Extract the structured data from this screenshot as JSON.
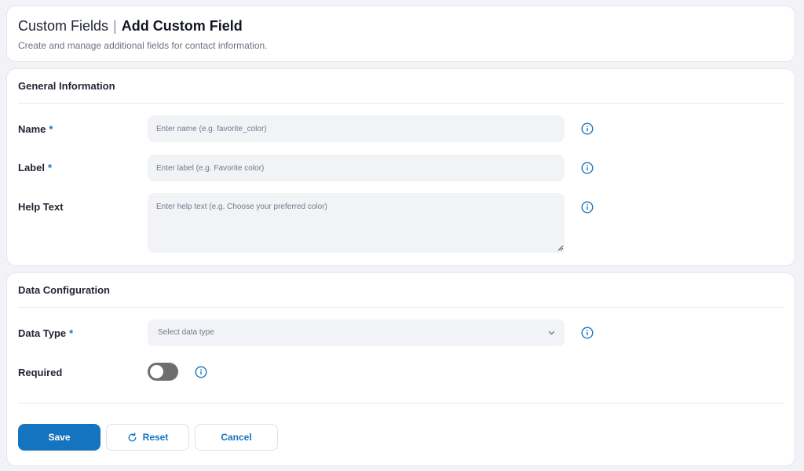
{
  "header": {
    "breadcrumb_parent": "Custom Fields",
    "separator": "|",
    "title": "Add Custom Field",
    "subtitle": "Create and manage additional fields for contact information."
  },
  "general": {
    "section_title": "General Information",
    "name": {
      "label": "Name",
      "required_mark": "*",
      "placeholder": "Enter name (e.g. favorite_color)",
      "value": ""
    },
    "label": {
      "label": "Label",
      "required_mark": "*",
      "placeholder": "Enter label (e.g. Favorite color)",
      "value": ""
    },
    "help_text": {
      "label": "Help Text",
      "placeholder": "Enter help text (e.g. Choose your preferred color)",
      "value": ""
    }
  },
  "config": {
    "section_title": "Data Configuration",
    "data_type": {
      "label": "Data Type",
      "required_mark": "*",
      "placeholder": "Select data type"
    },
    "required": {
      "label": "Required",
      "enabled": false
    }
  },
  "actions": {
    "save_label": "Save",
    "reset_label": "Reset",
    "cancel_label": "Cancel"
  },
  "icons": {
    "info": "info-circle-icon",
    "chevron": "chevron-down-icon",
    "reset": "refresh-icon"
  },
  "colors": {
    "accent": "#1574c0",
    "required_mark": "#1a73c2",
    "toggle_off": "#6e6e6e",
    "input_bg": "#f1f3f7"
  }
}
